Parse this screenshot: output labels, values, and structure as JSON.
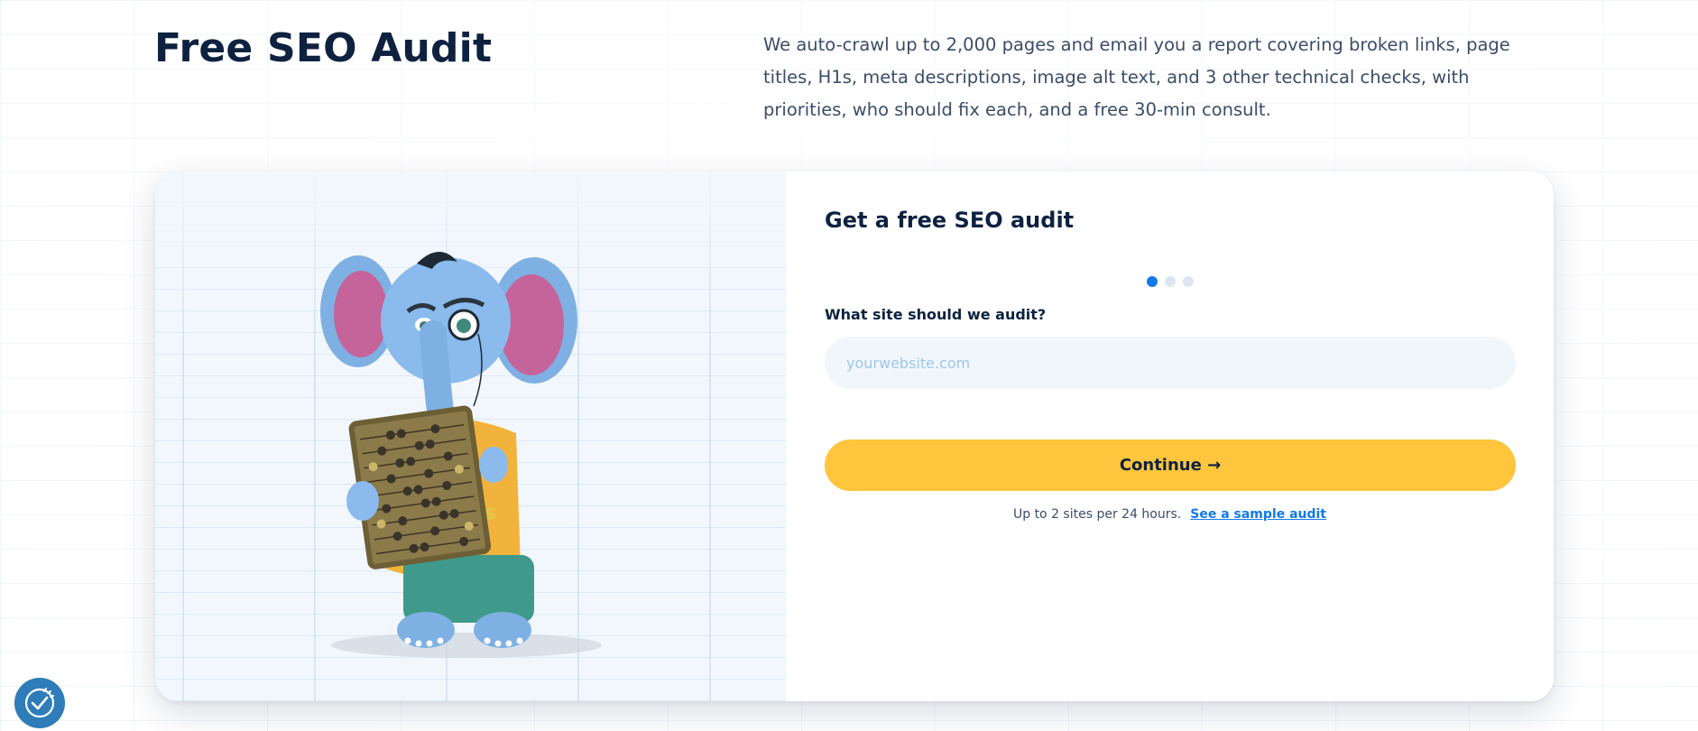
{
  "page": {
    "title": "Free SEO Audit",
    "intro": "We auto-crawl up to 2,000 pages and email you a report covering broken links, page titles, H1s, meta descriptions, image alt text, and 3 other technical checks, with priorities, who should fix each, and a free 30-min consult."
  },
  "form": {
    "title": "Get a free SEO audit",
    "steps": {
      "total": 3,
      "current": 1
    },
    "field_label": "What site should we audit?",
    "input_value": "",
    "input_placeholder": "yourwebsite.com",
    "continue_label": "Continue →",
    "limit_note": "Up to 2 sites per 24 hours.",
    "sample_link": "See a sample audit"
  },
  "icons": {
    "mascot": "elephant-with-abacus-illustration",
    "badge": "checkmark-badge-icon"
  },
  "colors": {
    "primary_text": "#0e2240",
    "accent_blue": "#1479e8",
    "button_yellow": "#fec53d",
    "input_bg": "#f1f6fb",
    "badge_blue": "#2f7db8"
  }
}
